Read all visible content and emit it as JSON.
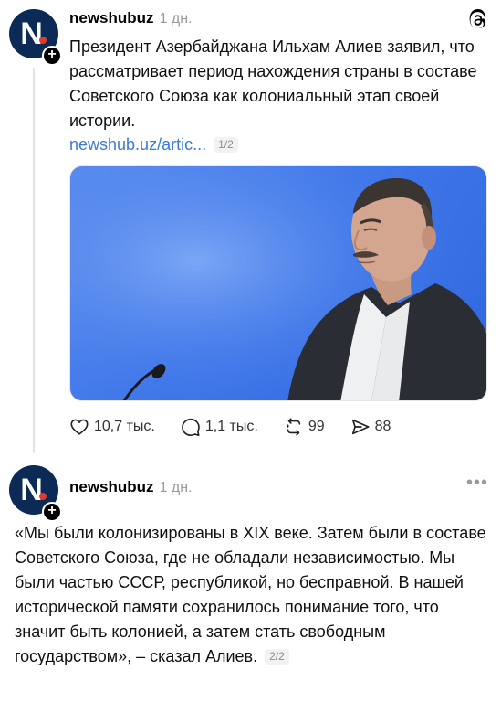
{
  "posts": [
    {
      "username": "newshubuz",
      "time": "1 дн.",
      "avatar_letter": "N",
      "text": "Президент Азербайджана Ильхам Алиев заявил, что рассматривает период нахождения страны в составе Советского Союза как колониальный этап своей истории.",
      "link": "newshub.uz/artic...",
      "counter": "1/2",
      "stats": {
        "likes": "10,7 тыс.",
        "comments": "1,1 тыс.",
        "reposts": "99",
        "shares": "88"
      },
      "icons": [
        "heart-icon",
        "comment-icon",
        "repost-icon",
        "share-icon",
        "threads-logo-icon"
      ]
    },
    {
      "username": "newshubuz",
      "time": "1 дн.",
      "avatar_letter": "N",
      "text": "«Мы были колонизированы в XIX веке. Затем были в составе Советского Союза, где не обладали независимостью. Мы были частью СССР, республикой, но бесправной. В нашей исторической памяти сохранилось понимание того, что значит быть колонией, а затем стать свободным государством», – сказал Алиев.",
      "counter": "2/2",
      "icons": [
        "more-icon"
      ]
    }
  ],
  "colors": {
    "avatar_bg": "#0b2a55",
    "link": "#3b7bd6",
    "photo_bg": "#3f77ea",
    "muted": "#9a9a9a"
  }
}
